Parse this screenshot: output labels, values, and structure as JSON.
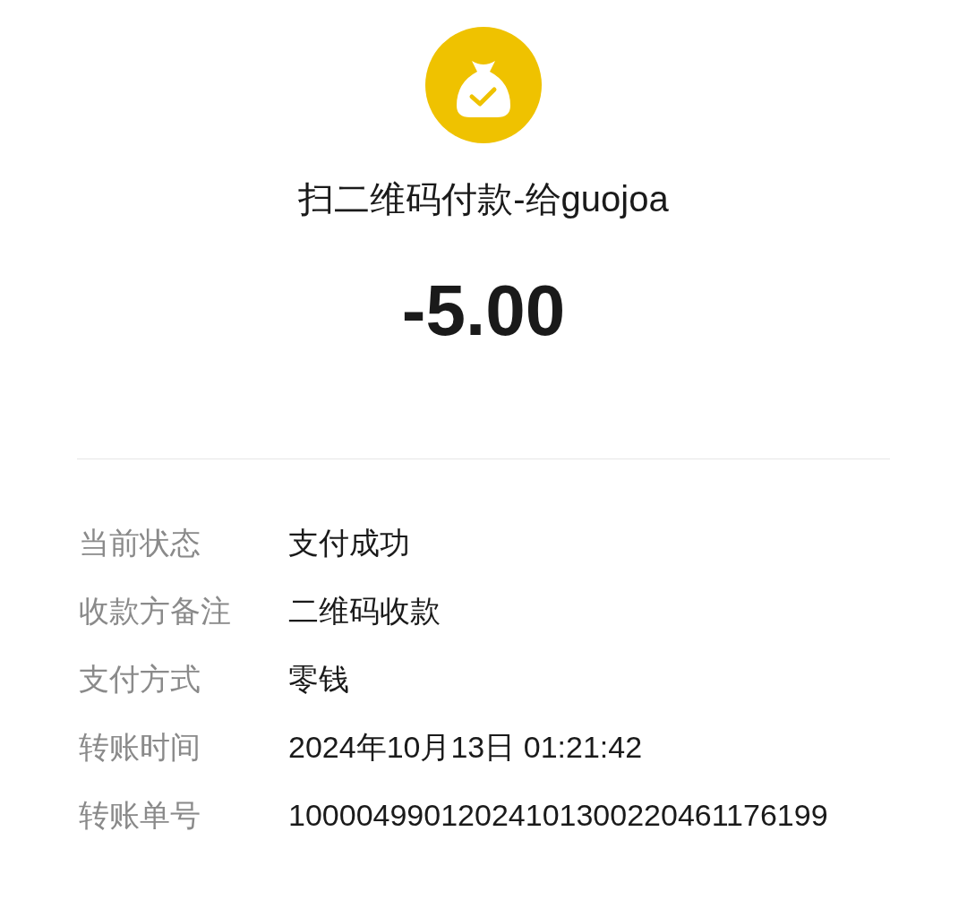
{
  "header": {
    "title": "扫二维码付款-给guojoa",
    "amount": "-5.00"
  },
  "details": [
    {
      "label": "当前状态",
      "value": "支付成功"
    },
    {
      "label": "收款方备注",
      "value": "二维码收款"
    },
    {
      "label": "支付方式",
      "value": "零钱"
    },
    {
      "label": "转账时间",
      "value": "2024年10月13日 01:21:42"
    },
    {
      "label": "转账单号",
      "value": "10000499012024101300220461176199"
    }
  ]
}
